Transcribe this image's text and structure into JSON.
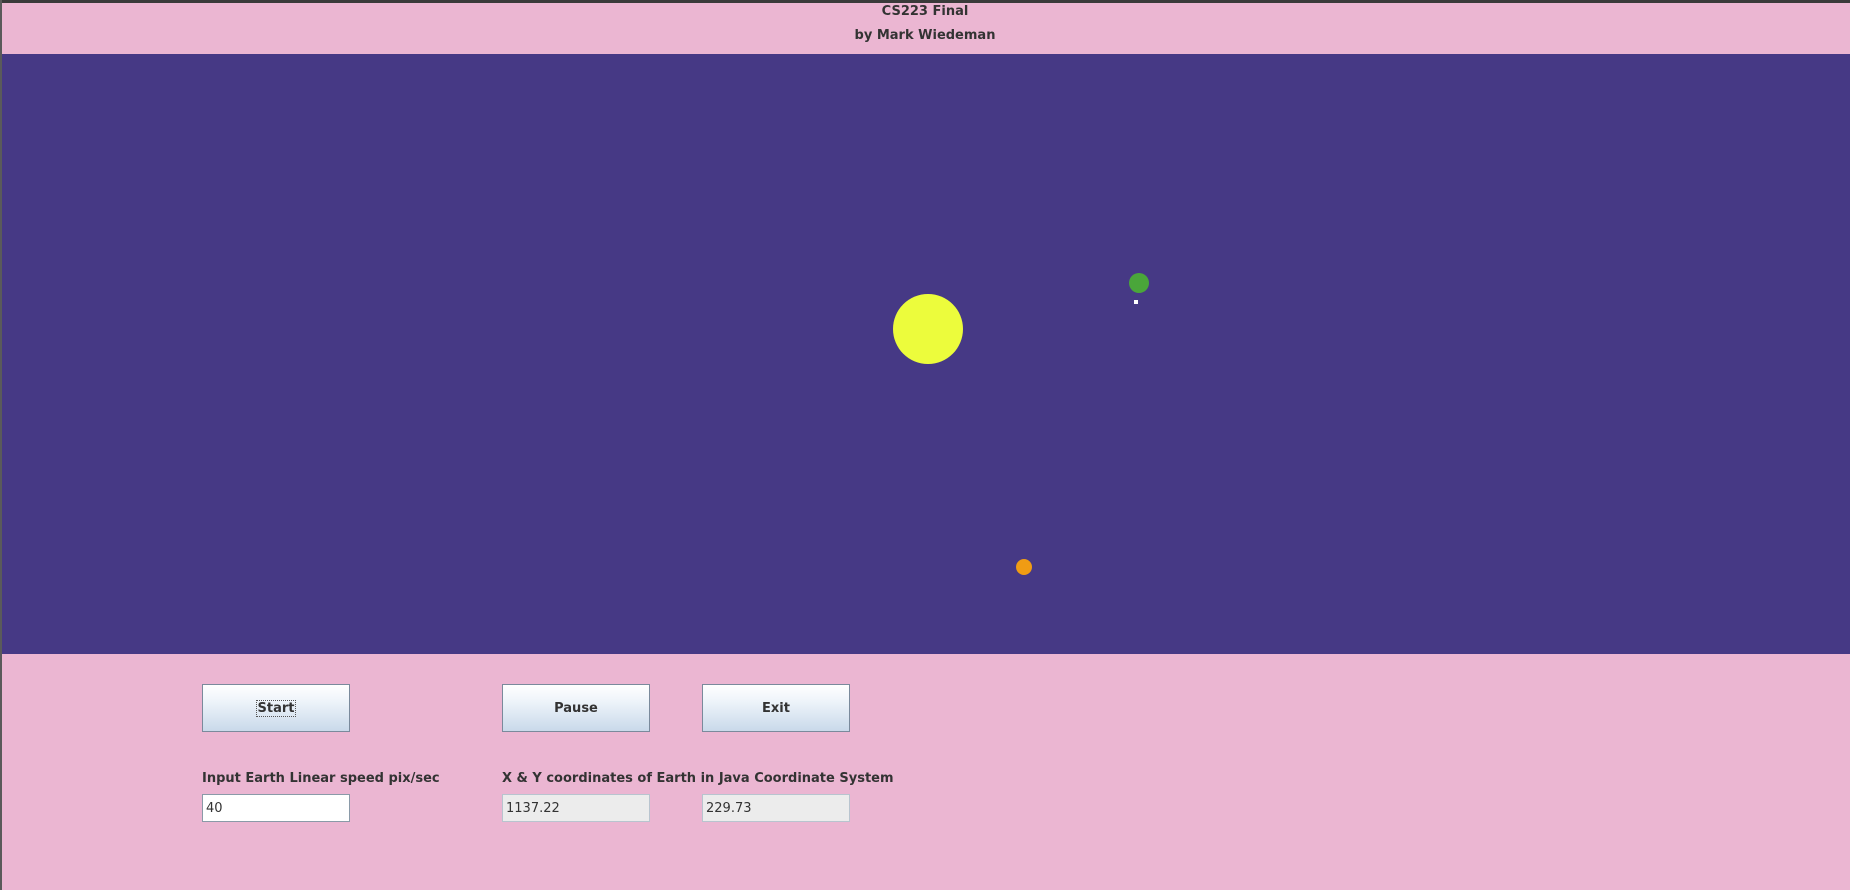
{
  "header": {
    "title": "CS223 Final",
    "author": "by Mark Wiedeman"
  },
  "scene": {
    "background_color": "#463985",
    "bodies": [
      {
        "name": "sun",
        "color": "#ecfc3c"
      },
      {
        "name": "earth",
        "color": "#4aa63a"
      },
      {
        "name": "moon",
        "color": "#ffffff"
      },
      {
        "name": "mercury",
        "color": "#f09c14"
      }
    ]
  },
  "controls": {
    "start_label": "Start",
    "pause_label": "Pause",
    "exit_label": "Exit",
    "speed_label": "Input Earth Linear speed pix/sec",
    "speed_value": "40",
    "coords_label": "X & Y coordinates of Earth in Java Coordinate System",
    "x_value": "1137.22",
    "y_value": "229.73"
  },
  "colors": {
    "panel_background": "#ebb6d2",
    "text": "#333333"
  }
}
